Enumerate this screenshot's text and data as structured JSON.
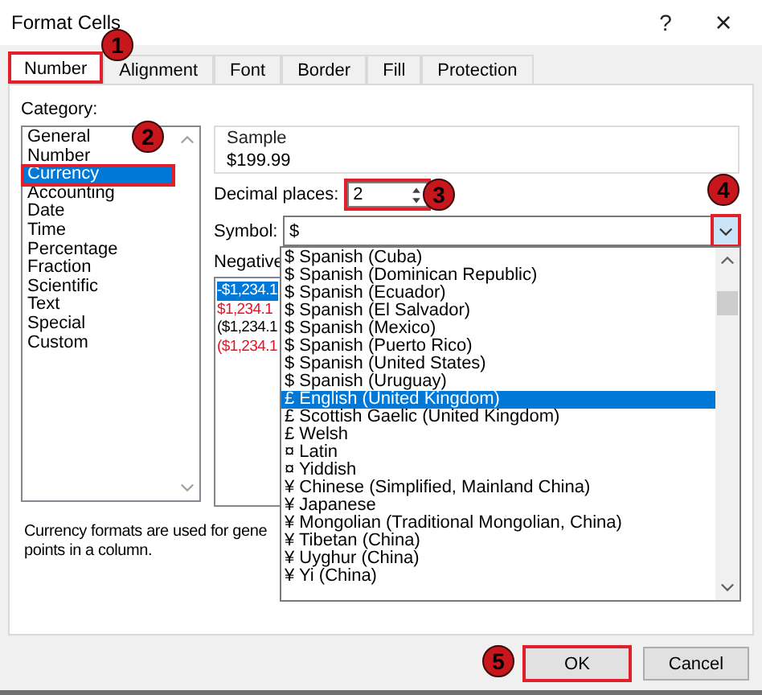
{
  "window": {
    "title": "Format Cells",
    "help": "?",
    "close": "×"
  },
  "tabs": [
    {
      "label": "Number",
      "selected": true,
      "highlighted": true
    },
    {
      "label": "Alignment",
      "selected": false,
      "highlighted": false
    },
    {
      "label": "Font",
      "selected": false,
      "highlighted": false
    },
    {
      "label": "Border",
      "selected": false,
      "highlighted": false
    },
    {
      "label": "Fill",
      "selected": false,
      "highlighted": false
    },
    {
      "label": "Protection",
      "selected": false,
      "highlighted": false
    }
  ],
  "category": {
    "label": "Category:",
    "items": [
      {
        "label": "General",
        "selected": false,
        "highlighted": false
      },
      {
        "label": "Number",
        "selected": false,
        "highlighted": false
      },
      {
        "label": "Currency",
        "selected": true,
        "highlighted": true
      },
      {
        "label": "Accounting",
        "selected": false,
        "highlighted": false
      },
      {
        "label": "Date",
        "selected": false,
        "highlighted": false
      },
      {
        "label": "Time",
        "selected": false,
        "highlighted": false
      },
      {
        "label": "Percentage",
        "selected": false,
        "highlighted": false
      },
      {
        "label": "Fraction",
        "selected": false,
        "highlighted": false
      },
      {
        "label": "Scientific",
        "selected": false,
        "highlighted": false
      },
      {
        "label": "Text",
        "selected": false,
        "highlighted": false
      },
      {
        "label": "Special",
        "selected": false,
        "highlighted": false
      },
      {
        "label": "Custom",
        "selected": false,
        "highlighted": false
      }
    ]
  },
  "sample": {
    "label": "Sample",
    "value": "$199.99"
  },
  "decimal_places": {
    "label": "Decimal places:",
    "value": "2",
    "highlighted": true
  },
  "symbol": {
    "label": "Symbol:",
    "value": "$",
    "expanded": true,
    "button_highlighted": true,
    "options": [
      {
        "label": "$ Spanish (Cuba)",
        "selected": false
      },
      {
        "label": "$ Spanish (Dominican Republic)",
        "selected": false
      },
      {
        "label": "$ Spanish (Ecuador)",
        "selected": false
      },
      {
        "label": "$ Spanish (El Salvador)",
        "selected": false
      },
      {
        "label": "$ Spanish (Mexico)",
        "selected": false
      },
      {
        "label": "$ Spanish (Puerto Rico)",
        "selected": false
      },
      {
        "label": "$ Spanish (United States)",
        "selected": false
      },
      {
        "label": "$ Spanish (Uruguay)",
        "selected": false
      },
      {
        "label": "£ English (United Kingdom)",
        "selected": true
      },
      {
        "label": "£ Scottish Gaelic (United Kingdom)",
        "selected": false
      },
      {
        "label": "£ Welsh",
        "selected": false
      },
      {
        "label": "¤ Latin",
        "selected": false
      },
      {
        "label": "¤ Yiddish",
        "selected": false
      },
      {
        "label": "¥ Chinese (Simplified, Mainland China)",
        "selected": false
      },
      {
        "label": "¥ Japanese",
        "selected": false
      },
      {
        "label": "¥ Mongolian (Traditional Mongolian, China)",
        "selected": false
      },
      {
        "label": "¥ Tibetan (China)",
        "selected": false
      },
      {
        "label": "¥ Uyghur (China)",
        "selected": false
      },
      {
        "label": "¥ Yi (China)",
        "selected": false
      }
    ]
  },
  "negative_numbers": {
    "label": "Negative",
    "items": [
      {
        "text": "-$1,234.1",
        "selected": true
      },
      {
        "text": "$1,234.1",
        "selected": false,
        "color": "#e81123"
      },
      {
        "text": "($1,234.1",
        "selected": false,
        "color": "#000000"
      },
      {
        "text": "($1,234.1",
        "selected": false,
        "color": "#e81123"
      }
    ]
  },
  "description": [
    "Currency formats are used for gene",
    "points in a column."
  ],
  "buttons": [
    {
      "label": "OK",
      "highlighted": true
    },
    {
      "label": "Cancel",
      "highlighted": false
    }
  ],
  "callouts": [
    {
      "number": "1"
    },
    {
      "number": "2"
    },
    {
      "number": "3"
    },
    {
      "number": "4"
    },
    {
      "number": "5"
    }
  ]
}
